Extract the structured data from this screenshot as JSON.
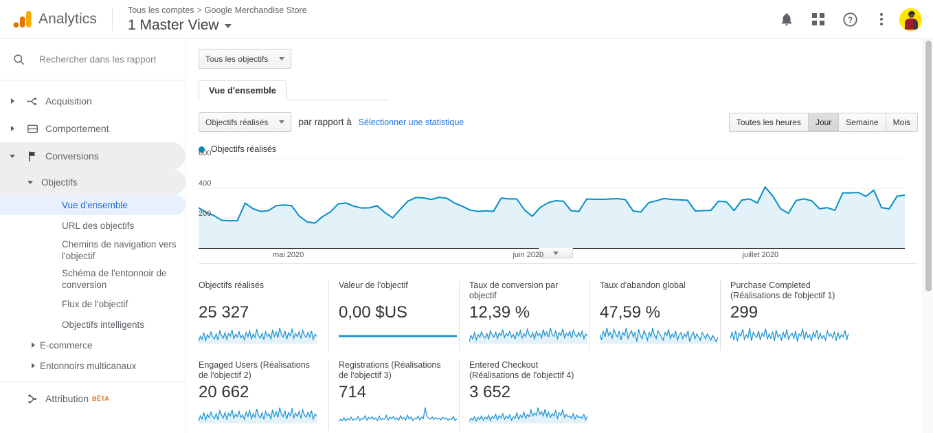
{
  "header": {
    "brand": "Analytics",
    "breadcrumb_account": "Tous les comptes",
    "breadcrumb_sep": ">",
    "breadcrumb_property": "Google Merchandise Store",
    "view_name": "1 Master View",
    "icons": {
      "bell": "notifications-bell-icon",
      "grid": "apps-grid-icon",
      "help": "help-circle-icon",
      "kebab": "more-vertical-icon",
      "avatar": "user-avatar"
    }
  },
  "sidebar": {
    "search_placeholder": "Rechercher dans les rapport",
    "search_value": "",
    "items": [
      {
        "label": "Acquisition",
        "icon": "acquisition-icon",
        "level": 1,
        "expanded": false
      },
      {
        "label": "Comportement",
        "icon": "behavior-icon",
        "level": 1,
        "expanded": false
      },
      {
        "label": "Conversions",
        "icon": "flag-icon",
        "level": 1,
        "expanded": true
      },
      {
        "label": "Objectifs",
        "level": 2,
        "expanded": true
      },
      {
        "label": "Vue d'ensemble",
        "level": 3,
        "active": true
      },
      {
        "label": "URL des objectifs",
        "level": 3,
        "active": false
      },
      {
        "label": "Chemins de navigation vers l'objectif",
        "level": 3,
        "active": false
      },
      {
        "label": "Schéma de l'entonnoir de conversion",
        "level": 3,
        "active": false
      },
      {
        "label": "Flux de l'objectif",
        "level": 3,
        "active": false
      },
      {
        "label": "Objectifs intelligents",
        "level": 3,
        "active": false
      },
      {
        "label": "E-commerce",
        "level": 2,
        "expanded": false
      },
      {
        "label": "Entonnoirs multicanaux",
        "level": 2,
        "expanded": false
      }
    ],
    "attribution": {
      "label": "Attribution",
      "badge": "BÊTA",
      "icon": "attribution-icon"
    }
  },
  "toolbar": {
    "goal_filter_label": "Tous les objectifs",
    "tab_overview": "Vue d'ensemble",
    "metric_select_label": "Objectifs réalisés",
    "compare_text": "par rapport à",
    "compare_link": "Sélectionner une statistique",
    "granularity": [
      {
        "label": "Toutes les heures",
        "selected": false
      },
      {
        "label": "Jour",
        "selected": true
      },
      {
        "label": "Semaine",
        "selected": false
      },
      {
        "label": "Mois",
        "selected": false
      }
    ]
  },
  "chart_data": {
    "type": "area",
    "title": "Objectifs réalisés",
    "legend": [
      "Objectifs réalisés"
    ],
    "legend_position": "top-left",
    "xlabel": "",
    "ylabel": "",
    "ylim": [
      0,
      600
    ],
    "yticks": [
      200,
      400,
      600
    ],
    "grid": true,
    "line_color": "#058dc7",
    "fill_color": "#e3f1f9",
    "x_tick_labels": [
      "mai 2020",
      "juin 2020",
      "juillet 2020"
    ],
    "x_tick_positions": [
      0.105,
      0.445,
      0.77
    ],
    "x": [
      "2020-04-22",
      "2020-04-23",
      "2020-04-24",
      "2020-04-25",
      "2020-04-26",
      "2020-04-27",
      "2020-04-28",
      "2020-04-29",
      "2020-04-30",
      "2020-05-01",
      "2020-05-02",
      "2020-05-03",
      "2020-05-04",
      "2020-05-05",
      "2020-05-06",
      "2020-05-07",
      "2020-05-08",
      "2020-05-09",
      "2020-05-10",
      "2020-05-11",
      "2020-05-12",
      "2020-05-13",
      "2020-05-14",
      "2020-05-15",
      "2020-05-16",
      "2020-05-17",
      "2020-05-18",
      "2020-05-19",
      "2020-05-20",
      "2020-05-21",
      "2020-05-22",
      "2020-05-23",
      "2020-05-24",
      "2020-05-25",
      "2020-05-26",
      "2020-05-27",
      "2020-05-28",
      "2020-05-29",
      "2020-05-30",
      "2020-05-31",
      "2020-06-01",
      "2020-06-02",
      "2020-06-03",
      "2020-06-04",
      "2020-06-05",
      "2020-06-06",
      "2020-06-07",
      "2020-06-08",
      "2020-06-09",
      "2020-06-10",
      "2020-06-11",
      "2020-06-12",
      "2020-06-13",
      "2020-06-14",
      "2020-06-15",
      "2020-06-16",
      "2020-06-17",
      "2020-06-18",
      "2020-06-19",
      "2020-06-20",
      "2020-06-21",
      "2020-06-22",
      "2020-06-23",
      "2020-06-24",
      "2020-06-25",
      "2020-06-26",
      "2020-06-27",
      "2020-06-28",
      "2020-06-29",
      "2020-06-30",
      "2020-07-01",
      "2020-07-02",
      "2020-07-03",
      "2020-07-04",
      "2020-07-05",
      "2020-07-06",
      "2020-07-07",
      "2020-07-08",
      "2020-07-09",
      "2020-07-10",
      "2020-07-11",
      "2020-07-12",
      "2020-07-13",
      "2020-07-14",
      "2020-07-15",
      "2020-07-16",
      "2020-07-17",
      "2020-07-18",
      "2020-07-19",
      "2020-07-20",
      "2020-07-21"
    ],
    "values": [
      272,
      240,
      219,
      188,
      186,
      186,
      302,
      266,
      247,
      253,
      285,
      290,
      285,
      215,
      178,
      170,
      214,
      245,
      297,
      303,
      282,
      270,
      271,
      285,
      240,
      205,
      262,
      316,
      339,
      337,
      326,
      341,
      334,
      302,
      281,
      256,
      248,
      251,
      248,
      335,
      330,
      330,
      257,
      215,
      273,
      304,
      318,
      315,
      252,
      247,
      329,
      328,
      327,
      329,
      332,
      325,
      250,
      244,
      305,
      318,
      333,
      326,
      324,
      321,
      250,
      252,
      254,
      315,
      311,
      253,
      322,
      330,
      303,
      409,
      348,
      264,
      235,
      320,
      330,
      318,
      265,
      272,
      255,
      370,
      370,
      372,
      347,
      388,
      272,
      265,
      348,
      355
    ]
  },
  "cards_row1": [
    {
      "title": "Objectifs réalisés",
      "value": "25 327",
      "sparkline": "area",
      "values": [
        38,
        52,
        44,
        60,
        41,
        56,
        48,
        63,
        50,
        45,
        58,
        42,
        66,
        54,
        47,
        61,
        44,
        59,
        52,
        68,
        46,
        57,
        50,
        64,
        48,
        55,
        43,
        62,
        51,
        66,
        45,
        58,
        49,
        70,
        54,
        47,
        60,
        43,
        64,
        52,
        58,
        45,
        69,
        51,
        63,
        48,
        74,
        56,
        50,
        66,
        44,
        61,
        53,
        72,
        47,
        59,
        51,
        64,
        46,
        68,
        55,
        49,
        62,
        50,
        66,
        44,
        57,
        52
      ]
    },
    {
      "title": "Valeur de l'objectif",
      "value": "0,00 $US",
      "sparkline": "flat"
    },
    {
      "title": "Taux de conversion par objectif",
      "value": "12,39 %",
      "sparkline": "area",
      "values": [
        30,
        44,
        36,
        50,
        34,
        46,
        40,
        52,
        42,
        38,
        48,
        36,
        54,
        45,
        40,
        51,
        37,
        49,
        44,
        56,
        39,
        48,
        43,
        53,
        40,
        46,
        36,
        51,
        43,
        55,
        38,
        48,
        41,
        58,
        45,
        40,
        50,
        36,
        53,
        44,
        48,
        38,
        57,
        43,
        52,
        40,
        61,
        46,
        42,
        54,
        37,
        50,
        44,
        59,
        39,
        49,
        43,
        53,
        38,
        56,
        45,
        41,
        51,
        42,
        54,
        37,
        47,
        43
      ]
    },
    {
      "title": "Taux d'abandon global",
      "value": "47,59 %",
      "sparkline": "area-high",
      "values": [
        62,
        58,
        64,
        60,
        66,
        61,
        63,
        59,
        65,
        62,
        60,
        64,
        58,
        63,
        61,
        66,
        59,
        62,
        64,
        60,
        63,
        57,
        65,
        61,
        59,
        64,
        62,
        58,
        63,
        60,
        66,
        61,
        59,
        64,
        62,
        60,
        58,
        63,
        61,
        65,
        59,
        62,
        60,
        64,
        58,
        61,
        63,
        59,
        62,
        60,
        64,
        57,
        61,
        63,
        59,
        62,
        60,
        58,
        63,
        61,
        59,
        62,
        60,
        58,
        61,
        59,
        57,
        60
      ]
    },
    {
      "title": "Purchase Completed (Réalisations de l'objectif 1)",
      "value": "299",
      "sparkline": "noisy",
      "values": [
        42,
        58,
        38,
        62,
        35,
        55,
        48,
        66,
        40,
        52,
        44,
        70,
        36,
        58,
        50,
        45,
        62,
        38,
        56,
        48,
        68,
        40,
        54,
        42,
        60,
        36,
        64,
        46,
        52,
        38,
        58,
        44,
        66,
        40,
        50,
        56,
        42,
        62,
        34,
        54,
        48,
        68,
        38,
        60,
        44,
        52,
        36,
        58,
        46,
        64,
        40,
        56,
        42,
        50,
        38,
        62,
        48,
        54,
        44,
        60,
        36,
        58,
        42,
        52,
        46,
        64,
        38,
        56
      ]
    }
  ],
  "cards_row2": [
    {
      "title": "Engaged Users (Réalisations de l'objectif 2)",
      "value": "20 662",
      "sparkline": "area",
      "values": [
        36,
        50,
        42,
        58,
        40,
        54,
        46,
        60,
        48,
        43,
        56,
        40,
        64,
        52,
        45,
        59,
        42,
        57,
        50,
        66,
        44,
        55,
        48,
        62,
        46,
        53,
        41,
        60,
        49,
        64,
        43,
        56,
        47,
        68,
        52,
        45,
        58,
        41,
        62,
        50,
        56,
        43,
        67,
        49,
        61,
        46,
        72,
        54,
        48,
        64,
        42,
        59,
        51,
        70,
        45,
        57,
        49,
        62,
        44,
        66,
        53,
        47,
        60,
        48,
        64,
        42,
        55,
        50
      ]
    },
    {
      "title": "Registrations (Réalisations de l'objectif 3)",
      "value": "714",
      "sparkline": "thin",
      "values": [
        28,
        34,
        30,
        38,
        29,
        36,
        32,
        40,
        31,
        35,
        33,
        42,
        30,
        37,
        34,
        44,
        31,
        39,
        35,
        41,
        33,
        38,
        30,
        43,
        32,
        36,
        34,
        45,
        31,
        40,
        36,
        42,
        33,
        38,
        31,
        44,
        35,
        39,
        32,
        46,
        34,
        41,
        30,
        37,
        35,
        43,
        32,
        40,
        36,
        68,
        42,
        38,
        34,
        41,
        33,
        39,
        35,
        37,
        32,
        40,
        34,
        38,
        31,
        36,
        33,
        42,
        30,
        35
      ]
    },
    {
      "title": "Entered Checkout (Réalisations de l'objectif 4)",
      "value": "3 652",
      "sparkline": "area",
      "values": [
        30,
        38,
        33,
        42,
        31,
        40,
        35,
        44,
        33,
        41,
        36,
        46,
        32,
        43,
        38,
        48,
        34,
        45,
        39,
        50,
        35,
        44,
        37,
        47,
        33,
        42,
        38,
        52,
        36,
        46,
        40,
        54,
        38,
        48,
        42,
        60,
        44,
        52,
        46,
        66,
        48,
        56,
        44,
        62,
        42,
        54,
        40,
        50,
        44,
        58,
        38,
        52,
        46,
        60,
        40,
        48,
        42,
        44,
        38,
        50,
        36,
        46,
        40,
        42,
        38,
        48,
        34,
        44
      ]
    }
  ]
}
